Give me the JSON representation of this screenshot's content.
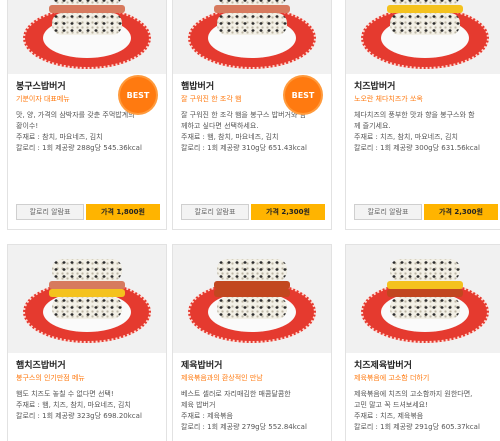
{
  "products": [
    {
      "name": "봉구스밥버거",
      "tagline": "기분이자 대표메뉴",
      "badge": "BEST",
      "description": [
        "맛, 양, 가격의 삼박자를 갖춘 주먹밥계의",
        "황이수!"
      ],
      "ingredients": "주재료 : 참치, 마요네즈, 김치",
      "calorie": "칼로리 : 1회 제공량 288g당 545.36kcal",
      "calorie_button": "칼로리 알람표",
      "price_label": "가격 1,800원"
    },
    {
      "name": "햄밥버거",
      "tagline": "잘 구워진 한 조각 햄",
      "badge": "BEST",
      "description": [
        "잘 구워진 한 조각 햄을 봉구스 밥버거와 함",
        "께하고 싶다면 선택하세요."
      ],
      "ingredients": "주재료 : 햄, 참치, 마요네즈, 김치",
      "calorie": "칼로리 : 1회 제공량 310g당 651.43kcal",
      "calorie_button": "칼로리 알람표",
      "price_label": "가격 2,300원"
    },
    {
      "name": "치즈밥버거",
      "tagline": "노오란 체다치즈가 쏘옥",
      "badge": "",
      "description": [
        "체다치즈의 풍부한 맛과 향을 봉구스와 함",
        "께 즐기세요."
      ],
      "ingredients": "주재료 : 치즈, 참치, 마요네즈, 김치",
      "calorie": "칼로리 : 1회 제공량 300g당 631.56kcal",
      "calorie_button": "칼로리 알람표",
      "price_label": "가격 2,300원"
    },
    {
      "name": "햄치즈밥버거",
      "tagline": "봉구스의 인기만점 메뉴",
      "badge": "",
      "description": [
        "햄도 치즈도 놓칠 수 없다면 선택!"
      ],
      "ingredients": "주재료 : 햄, 치즈, 참치, 마요네즈, 김치",
      "calorie": "칼로리 : 1회 제공량 323g당 698.20kcal",
      "calorie_button": "",
      "price_label": ""
    },
    {
      "name": "제육밥버거",
      "tagline": "제육볶음과의 환상적인 만남",
      "badge": "",
      "description": [
        "베스트 셀러로 자리매김한 매콤달콤한",
        "제육 밥버거"
      ],
      "ingredients": "주재료 : 제육볶음",
      "calorie": "칼로리 : 1회 제공량 279g당 552.84kcal",
      "calorie_button": "",
      "price_label": ""
    },
    {
      "name": "치즈제육밥버거",
      "tagline": "제육볶음에 고소함 더하기",
      "badge": "",
      "description": [
        "제육볶음에 치즈의 고소함까지 원한다면,",
        "고민 말고 꼭 드셔보세요!"
      ],
      "ingredients": "주재료 : 치즈, 제육볶음",
      "calorie": "칼로리 : 1회 제공량 291g당 605.37kcal",
      "calorie_button": "",
      "price_label": ""
    }
  ],
  "colors": {
    "accent_orange": "#ff7a10",
    "price_button": "#ffb400",
    "plate_red": "#e53a2f"
  }
}
